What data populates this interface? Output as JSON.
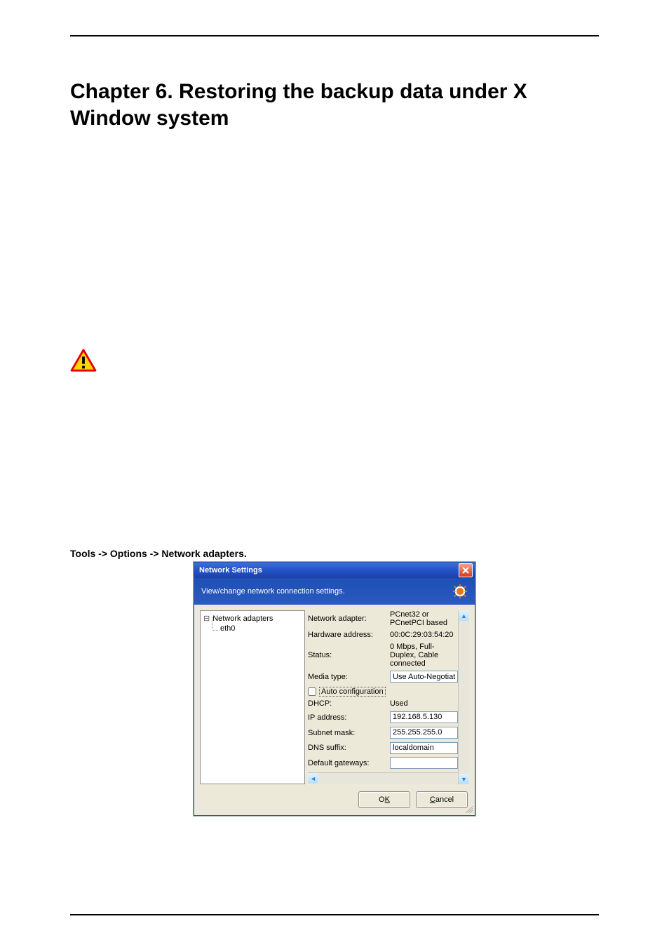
{
  "chapter_title": "Chapter 6.  Restoring the backup data under X Window system",
  "menu_path": "Tools -> Options -> Network adapters.",
  "dialog": {
    "title": "Network Settings",
    "subtitle": "View/change network connection settings.",
    "tree": {
      "root": "Network adapters",
      "child": "eth0"
    },
    "rows": {
      "adapter_label": "Network adapter:",
      "adapter_value": "PCnet32 or PCnetPCI based",
      "hw_label": "Hardware address:",
      "hw_value": "00:0C:29:03:54:20",
      "status_label": "Status:",
      "status_value": "0 Mbps, Full-Duplex, Cable connected",
      "media_label": "Media type:",
      "media_value": "Use Auto-Negotiation",
      "auto_label": "Auto configuration",
      "dhcp_label": "DHCP:",
      "dhcp_value": "Used",
      "ip_label": "IP address:",
      "ip_value": "192.168.5.130",
      "mask_label": "Subnet mask:",
      "mask_value": "255.255.255.0",
      "dns_label": "DNS suffix:",
      "dns_value": "localdomain",
      "gw_label": "Default gateways:"
    },
    "buttons": {
      "ok_pre": "O",
      "ok_u": "K",
      "cancel_u": "C",
      "cancel_post": "ancel"
    }
  }
}
